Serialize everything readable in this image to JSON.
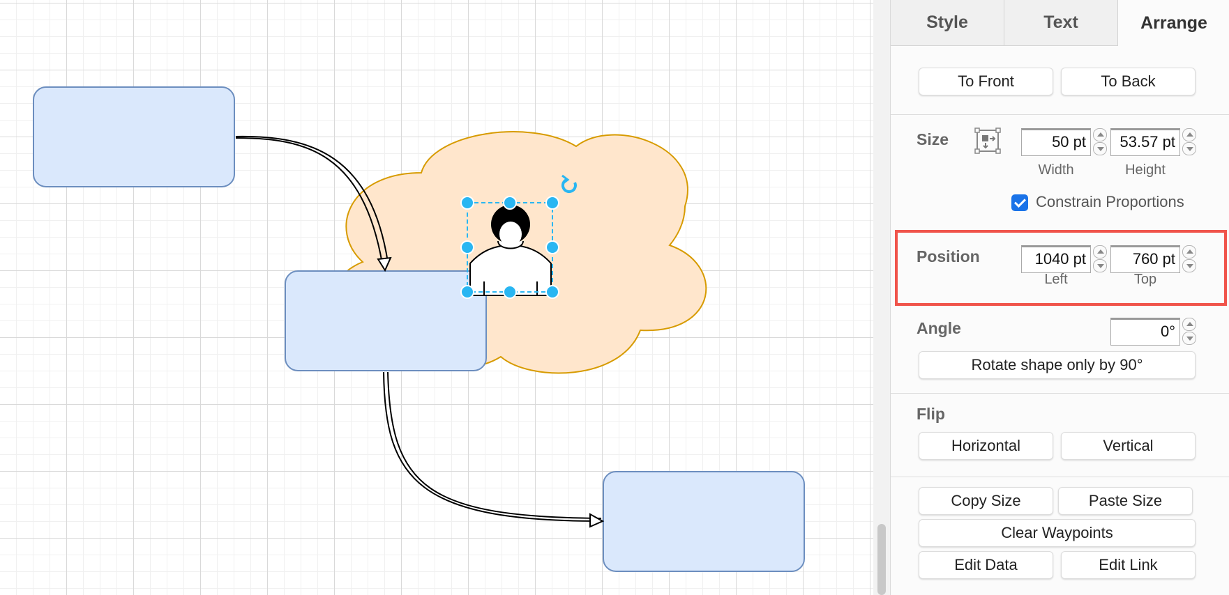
{
  "tabs": [
    {
      "label": "Style"
    },
    {
      "label": "Text"
    },
    {
      "label": "Arrange"
    }
  ],
  "order": {
    "to_front": "To Front",
    "to_back": "To Back"
  },
  "size": {
    "label": "Size",
    "width_value": "50 pt",
    "height_value": "53.57 pt",
    "width_label": "Width",
    "height_label": "Height",
    "constrain_label": "Constrain Proportions",
    "constrain_checked": true,
    "icon": "autosize-icon"
  },
  "position": {
    "label": "Position",
    "left_value": "1040 pt",
    "top_value": "760 pt",
    "left_label": "Left",
    "top_label": "Top"
  },
  "angle": {
    "label": "Angle",
    "value": "0°",
    "rotate_button": "Rotate shape only by 90°"
  },
  "flip": {
    "label": "Flip",
    "horizontal": "Horizontal",
    "vertical": "Vertical"
  },
  "actions": {
    "copy_size": "Copy Size",
    "paste_size": "Paste Size",
    "clear_waypoints": "Clear Waypoints",
    "edit_data": "Edit Data",
    "edit_link": "Edit Link"
  },
  "colors": {
    "box_fill": "#dae8fc",
    "box_stroke": "#6c8ebf",
    "cloud_fill": "#ffe6cc",
    "cloud_stroke": "#d79b00",
    "selection_handle": "#29b6f2",
    "highlight": "#f0544b",
    "checkbox": "#1a73e8"
  }
}
